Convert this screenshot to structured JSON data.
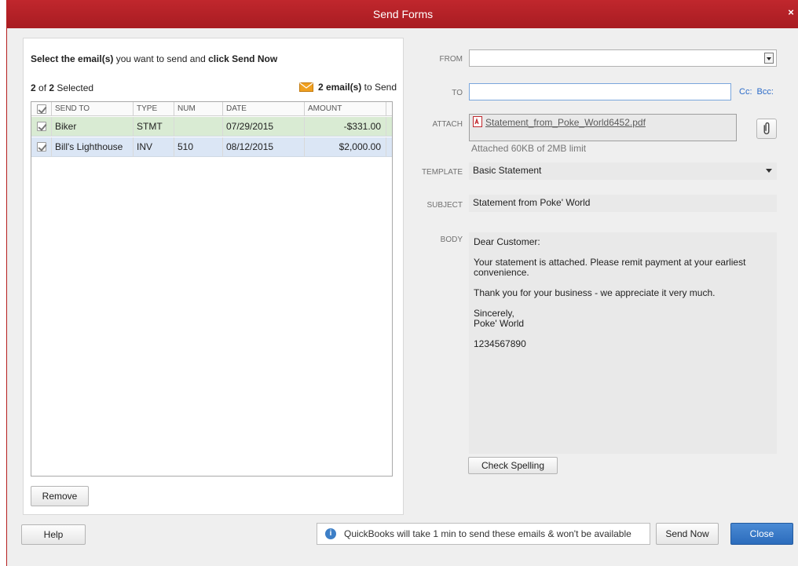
{
  "window": {
    "title": "Send Forms",
    "close_glyph": "×"
  },
  "left": {
    "instruction_prefix": "Select the email(s)",
    "instruction_mid": " you want to send and ",
    "instruction_suffix": "click Send Now",
    "selected_num": "2",
    "selected_of": " of ",
    "selected_total": "2",
    "selected_word": " Selected",
    "email_count_bold": "2 email(s)",
    "email_count_rest": " to Send",
    "columns": [
      "SEND TO",
      "TYPE",
      "NUM",
      "DATE",
      "AMOUNT"
    ],
    "rows": [
      {
        "send_to": "Biker",
        "type": "STMT",
        "num": "",
        "date": "07/29/2015",
        "amount": "-$331.00",
        "color": "#d9ebd3"
      },
      {
        "send_to": "Bill's Lighthouse",
        "type": "INV",
        "num": "510",
        "date": "08/12/2015",
        "amount": "$2,000.00",
        "color": "#dbe6f5"
      }
    ],
    "remove_label": "Remove"
  },
  "form": {
    "from_label": "FROM",
    "from_value": "",
    "to_label": "TO",
    "to_value": "",
    "cc_label": "Cc:",
    "bcc_label": "Bcc:",
    "attach_label": "ATTACH",
    "attach_file": "Statement_from_Poke_World6452.pdf",
    "attach_note": "Attached 60KB of 2MB limit",
    "template_label": "TEMPLATE",
    "template_value": "Basic Statement",
    "subject_label": "SUBJECT",
    "subject_value": "Statement from Poke' World",
    "body_label": "BODY",
    "body_lines": [
      "Dear Customer:",
      "",
      "Your statement is attached.  Please remit payment at your earliest",
      "convenience.",
      "",
      "Thank you for your business - we appreciate it very much.",
      "",
      "Sincerely,",
      "Poke' World",
      "",
      "1234567890"
    ],
    "check_spelling_label": "Check Spelling"
  },
  "footer": {
    "help_label": "Help",
    "info_text": "QuickBooks will take 1 min to send these emails & won't be available",
    "send_now_label": "Send Now",
    "close_label": "Close"
  },
  "colors": {
    "titlebar": "#b8232a",
    "accent_blue": "#2c6cbc",
    "row_green": "#d9ebd3",
    "row_blue": "#dbe6f5",
    "envelope": "#f0a020"
  },
  "icons": {
    "envelope": "envelope-icon",
    "pdf": "pdf-file-icon",
    "paperclip": "paperclip-icon",
    "info": "info-icon",
    "close": "close-icon"
  }
}
